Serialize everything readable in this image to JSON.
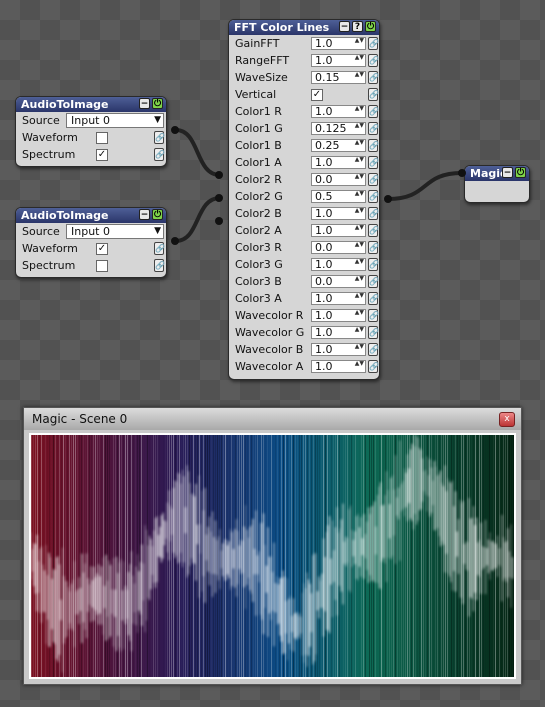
{
  "nodes": {
    "audio1": {
      "title": "AudioToImage",
      "source_label": "Source",
      "source_value": "Input 0",
      "waveform_label": "Waveform",
      "waveform_checked": false,
      "spectrum_label": "Spectrum",
      "spectrum_checked": true
    },
    "audio2": {
      "title": "AudioToImage",
      "source_label": "Source",
      "source_value": "Input 0",
      "waveform_label": "Waveform",
      "waveform_checked": true,
      "spectrum_label": "Spectrum",
      "spectrum_checked": false
    },
    "fft": {
      "title": "FFT Color Lines",
      "params": [
        {
          "label": "GainFFT",
          "value": "1.0"
        },
        {
          "label": "RangeFFT",
          "value": "1.0"
        },
        {
          "label": "WaveSize",
          "value": "0.15"
        },
        {
          "label": "Vertical",
          "value": "✓",
          "checkbox": true
        },
        {
          "label": "Color1 R",
          "value": "1.0"
        },
        {
          "label": "Color1 G",
          "value": "0.125"
        },
        {
          "label": "Color1 B",
          "value": "0.25"
        },
        {
          "label": "Color1 A",
          "value": "1.0"
        },
        {
          "label": "Color2 R",
          "value": "0.0"
        },
        {
          "label": "Color2 G",
          "value": "0.5"
        },
        {
          "label": "Color2 B",
          "value": "1.0"
        },
        {
          "label": "Color2 A",
          "value": "1.0"
        },
        {
          "label": "Color3 R",
          "value": "0.0"
        },
        {
          "label": "Color3 G",
          "value": "1.0"
        },
        {
          "label": "Color3 B",
          "value": "0.0"
        },
        {
          "label": "Color3 A",
          "value": "1.0"
        },
        {
          "label": "Wavecolor R",
          "value": "1.0"
        },
        {
          "label": "Wavecolor G",
          "value": "1.0"
        },
        {
          "label": "Wavecolor B",
          "value": "1.0"
        },
        {
          "label": "Wavecolor A",
          "value": "1.0"
        }
      ]
    },
    "magic": {
      "title": "Magic"
    }
  },
  "icons": {
    "collapse": "minus-icon",
    "enable": "power-icon",
    "help": "question-icon",
    "lock": "lock-icon",
    "dropdown": "triangle-down-icon",
    "checkmark": "checkmark-icon",
    "close": "close-icon"
  },
  "window": {
    "title": "Magic - Scene 0",
    "close_glyph": "x",
    "colors": [
      "#7a1020",
      "#2a1a55",
      "#0a4d86",
      "#0d6a55",
      "#062615"
    ]
  },
  "glyphs": {
    "minus": "−",
    "power": "⏻",
    "question": "?",
    "lock": "🔗",
    "down": "▼",
    "check": "✓",
    "arrows": "▲▼"
  }
}
